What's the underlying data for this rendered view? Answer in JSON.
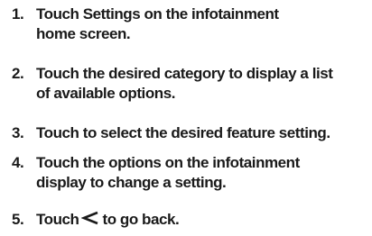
{
  "steps": [
    {
      "number": "1.",
      "lines": [
        "Touch Settings on the infotainment",
        "home screen."
      ]
    },
    {
      "number": "2.",
      "lines": [
        "Touch the desired category to display a list",
        "of available options."
      ]
    },
    {
      "number": "3.",
      "lines": [
        "Touch to select the desired feature setting."
      ]
    },
    {
      "number": "4.",
      "lines": [
        "Touch the options on the infotainment",
        "display to change a setting."
      ]
    },
    {
      "number": "5.",
      "prefix": "Touch",
      "icon": "back-chevron-icon",
      "suffix": "to go back."
    }
  ]
}
